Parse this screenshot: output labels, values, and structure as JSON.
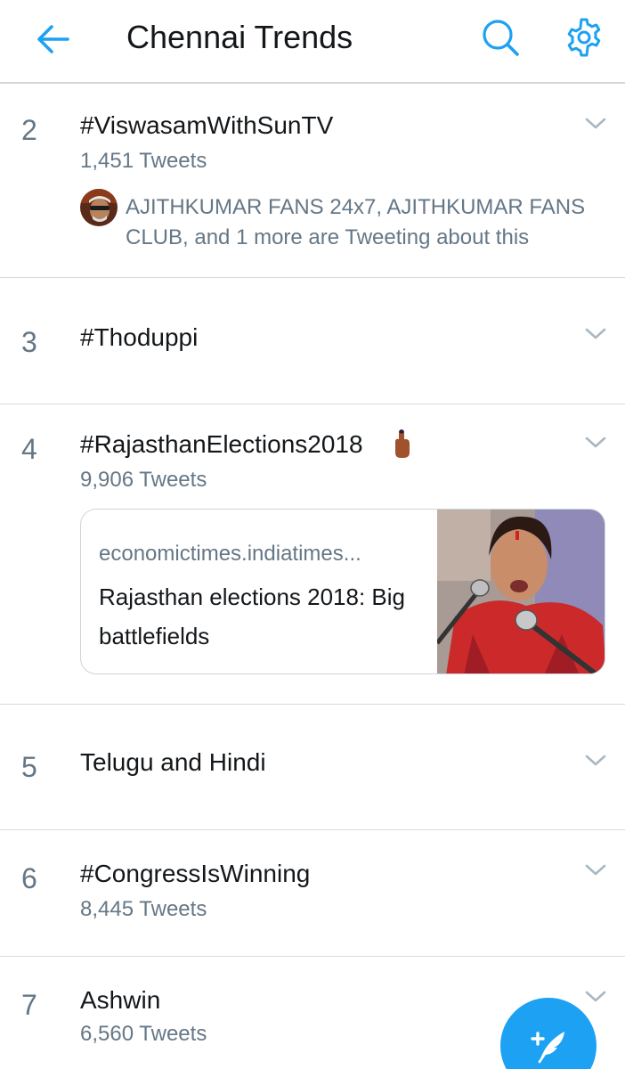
{
  "header": {
    "title": "Chennai Trends",
    "back_icon": "arrow-left-icon",
    "search_icon": "search-icon",
    "settings_icon": "gear-icon",
    "accent_color": "#1da1f2"
  },
  "trends": [
    {
      "rank": "2",
      "name": "#ViswasamWithSunTV",
      "count": "1,451 Tweets",
      "context": "AJITHKUMAR FANS 24x7, AJITHKUMAR FANS CLUB, and 1 more are Tweeting about this"
    },
    {
      "rank": "3",
      "name": "#Thoduppi"
    },
    {
      "rank": "4",
      "name": "#RajasthanElections2018",
      "emoji_icon": "voting-finger-icon",
      "count": "9,906 Tweets",
      "card": {
        "domain": "economictimes.indiatimes...",
        "title": "Rajasthan elections 2018: Big battlefields",
        "image": "speaker-at-microphone-photo"
      }
    },
    {
      "rank": "5",
      "name": "Telugu and Hindi"
    },
    {
      "rank": "6",
      "name": "#CongressIsWinning",
      "count": "8,445 Tweets"
    },
    {
      "rank": "7",
      "name": "Ashwin",
      "count": "6,560 Tweets"
    }
  ],
  "compose_icon": "compose-tweet-icon"
}
